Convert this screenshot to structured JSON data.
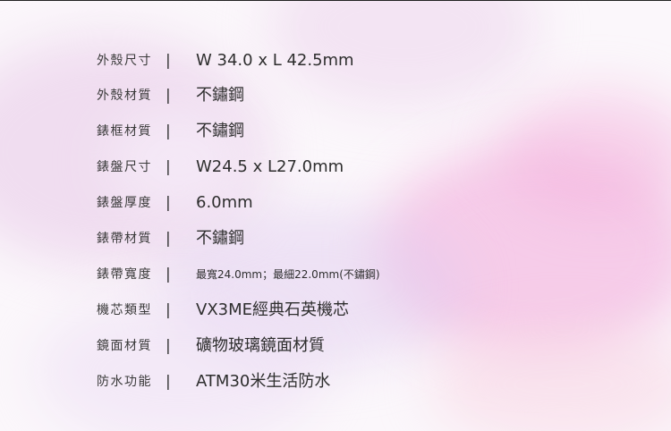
{
  "specs": [
    {
      "label": "外殼尺寸",
      "separator": "|",
      "value": "W 34.0 x L 42.5mm"
    },
    {
      "label": "外殼材質",
      "separator": "|",
      "value": "不鏽鋼"
    },
    {
      "label": "錶框材質",
      "separator": "|",
      "value": "不鏽鋼"
    },
    {
      "label": "錶盤尺寸",
      "separator": "|",
      "value": "W24.5 x L27.0mm"
    },
    {
      "label": "錶盤厚度",
      "separator": "|",
      "value": "6.0mm"
    },
    {
      "label": "錶帶材質",
      "separator": "|",
      "value": "不鏽鋼"
    },
    {
      "label": "錶帶寬度",
      "separator": "|",
      "value": "最寬24.0mm；最細22.0mm(不鏽鋼)"
    },
    {
      "label": "機芯類型",
      "separator": "|",
      "value": "VX3ME經典石英機芯"
    },
    {
      "label": "鏡面材質",
      "separator": "|",
      "value": "礦物玻璃鏡面材質"
    },
    {
      "label": "防水功能",
      "separator": "|",
      "value": "ATM30米生活防水"
    }
  ]
}
